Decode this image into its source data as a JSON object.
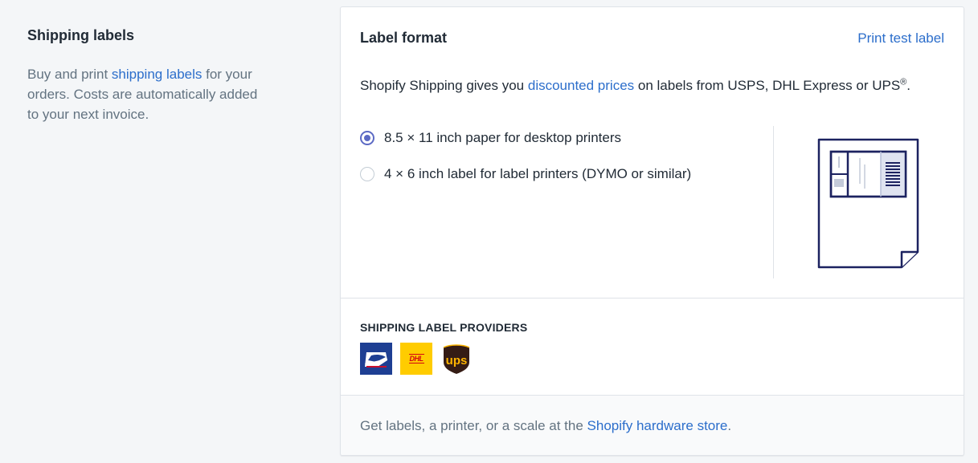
{
  "annotated_section": {
    "title": "Shipping labels",
    "desc_prefix": "Buy and print ",
    "desc_link": "shipping labels",
    "desc_suffix": " for your orders. Costs are automatically added to your next invoice."
  },
  "card": {
    "title": "Label format",
    "header_action": "Print test label",
    "intro_prefix": "Shopify Shipping gives you ",
    "intro_link": "discounted prices",
    "intro_suffix": " on labels from USPS, DHL Express or UPS",
    "intro_mark": "®",
    "intro_end": ".",
    "options": [
      {
        "label": "8.5 × 11 inch paper for desktop printers",
        "checked": true
      },
      {
        "label": "4 × 6 inch label for label printers (DYMO or similar)",
        "checked": false
      }
    ],
    "illustration_icon": "label-sheet-illustration"
  },
  "providers": {
    "title": "SHIPPING LABEL PROVIDERS",
    "items": [
      {
        "name": "usps-logo-icon",
        "color": "#1e3f93"
      },
      {
        "name": "dhl-logo-icon",
        "color": "#ffcc00",
        "text": "DHL"
      },
      {
        "name": "ups-logo-icon",
        "color": "#351c15",
        "text": "ups"
      }
    ]
  },
  "footer": {
    "prefix": "Get labels, a printer, or a scale at the ",
    "link": "Shopify hardware store",
    "suffix": "."
  },
  "colors": {
    "accent": "#5c6ac4",
    "link": "#2c6ecb",
    "background": "#f4f6f8"
  }
}
